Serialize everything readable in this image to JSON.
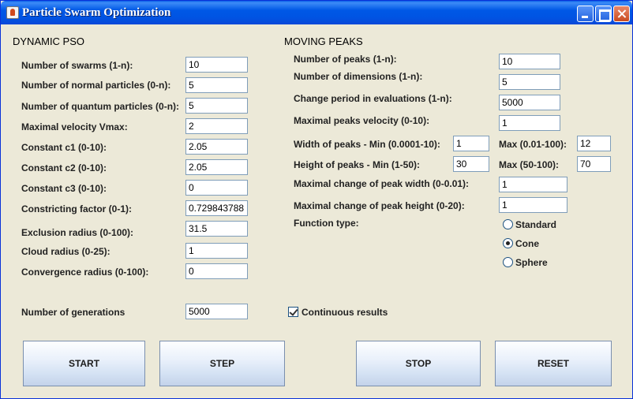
{
  "window": {
    "title": "Particle Swarm Optimization"
  },
  "dynamic_pso": {
    "title": "DYNAMIC PSO",
    "fields": [
      {
        "label": "Number of swarms (1-n):",
        "value": "10"
      },
      {
        "label": "Number of normal particles (0-n):",
        "value": "5"
      },
      {
        "label": "Number of quantum particles (0-n):",
        "value": "5"
      },
      {
        "label": "Maximal velocity Vmax:",
        "value": "2"
      },
      {
        "label": "Constant c1 (0-10):",
        "value": "2.05"
      },
      {
        "label": "Constant c2 (0-10):",
        "value": "2.05"
      },
      {
        "label": "Constant c3 (0-10):",
        "value": "0"
      },
      {
        "label": "Constricting factor (0-1):",
        "value": "0.729843788"
      },
      {
        "label": "Exclusion radius (0-100):",
        "value": "31.5"
      },
      {
        "label": "Cloud radius (0-25):",
        "value": "1"
      },
      {
        "label": "Convergence radius (0-100):",
        "value": "0"
      }
    ],
    "generations": {
      "label": "Number of generations",
      "value": "5000"
    }
  },
  "moving_peaks": {
    "title": "MOVING PEAKS",
    "fields": [
      {
        "label": "Number of peaks (1-n):",
        "value": "10"
      },
      {
        "label": "Number of dimensions (1-n):",
        "value": "5"
      },
      {
        "label": "Change period in evaluations (1-n):",
        "value": "5000"
      },
      {
        "label": "Maximal peaks velocity (0-10):",
        "value": "1"
      }
    ],
    "width": {
      "label": "Width of peaks -  Min (0.0001-10):",
      "min": "1",
      "max_label": "Max (0.01-100):",
      "max": "12"
    },
    "height": {
      "label": "Height of peaks -  Min (1-50):",
      "min": "30",
      "max_label": "Max (50-100):",
      "max": "70"
    },
    "change_width": {
      "label": "Maximal change of peak width (0-0.01):",
      "value": "1"
    },
    "change_height": {
      "label": "Maximal change of peak height (0-20):",
      "value": "1"
    },
    "function_type": {
      "label": "Function type:",
      "options": [
        "Standard",
        "Cone",
        "Sphere"
      ],
      "selected": "Cone"
    },
    "continuous": {
      "label": "Continuous results",
      "checked": true
    }
  },
  "buttons": {
    "start": "START",
    "step": "STEP",
    "stop": "STOP",
    "reset": "RESET"
  }
}
